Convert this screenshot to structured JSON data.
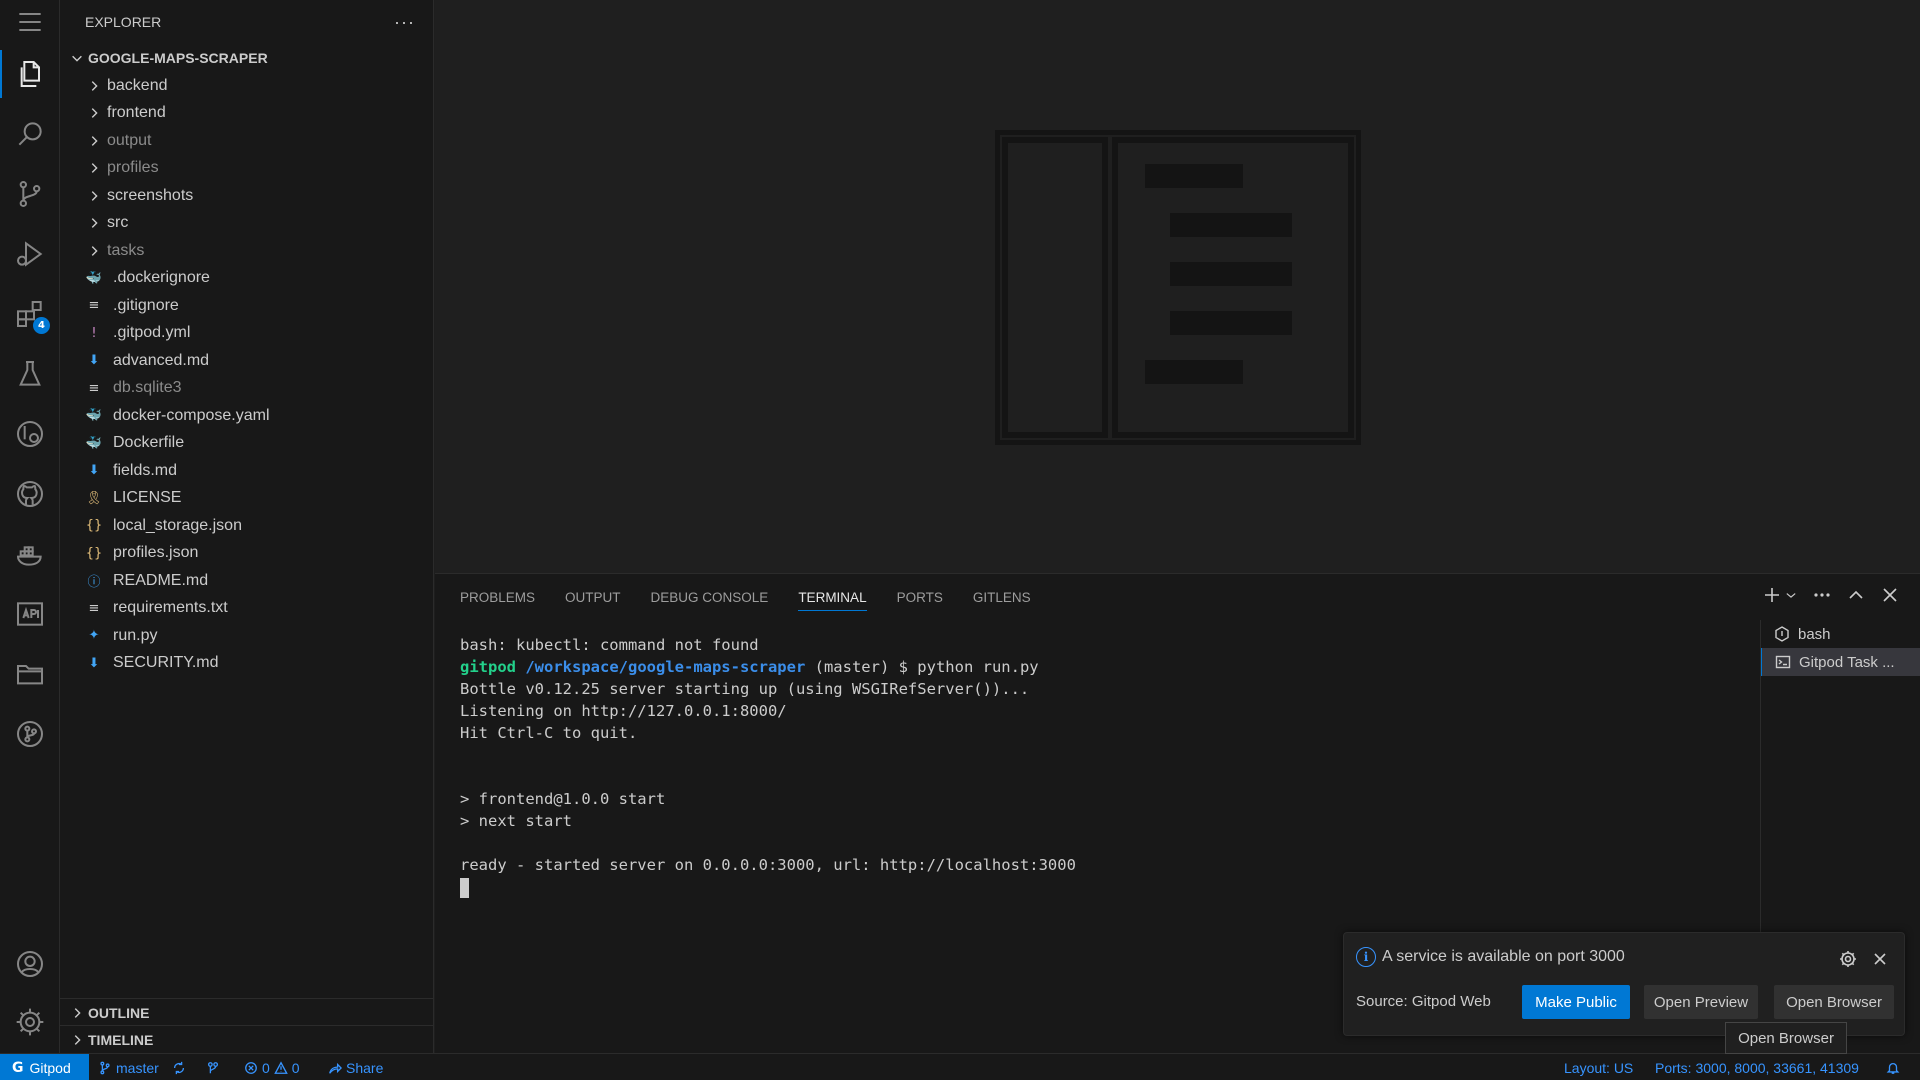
{
  "explorer": {
    "title": "EXPLORER",
    "more": "···",
    "root": "GOOGLE-MAPS-SCRAPER",
    "folders": [
      {
        "name": "backend",
        "dim": false
      },
      {
        "name": "frontend",
        "dim": false
      },
      {
        "name": "output",
        "dim": true
      },
      {
        "name": "profiles",
        "dim": true
      },
      {
        "name": "screenshots",
        "dim": false
      },
      {
        "name": "src",
        "dim": false
      },
      {
        "name": "tasks",
        "dim": true
      }
    ],
    "files": [
      {
        "name": ".dockerignore",
        "icon": "docker-icon",
        "dim": false
      },
      {
        "name": ".gitignore",
        "icon": "lines-icon",
        "dim": false
      },
      {
        "name": ".gitpod.yml",
        "icon": "exclamation-icon",
        "dim": false
      },
      {
        "name": "advanced.md",
        "icon": "markdown-arrow-icon",
        "dim": false
      },
      {
        "name": "db.sqlite3",
        "icon": "lines-icon",
        "dim": true
      },
      {
        "name": "docker-compose.yaml",
        "icon": "docker-compose-icon",
        "dim": false
      },
      {
        "name": "Dockerfile",
        "icon": "docker-icon",
        "dim": false
      },
      {
        "name": "fields.md",
        "icon": "markdown-arrow-icon",
        "dim": false
      },
      {
        "name": "LICENSE",
        "icon": "license-ribbon-icon",
        "dim": false
      },
      {
        "name": "local_storage.json",
        "icon": "json-braces-icon",
        "dim": false
      },
      {
        "name": "profiles.json",
        "icon": "json-braces-icon",
        "dim": false
      },
      {
        "name": "README.md",
        "icon": "info-icon",
        "dim": false
      },
      {
        "name": "requirements.txt",
        "icon": "lines-icon",
        "dim": false
      },
      {
        "name": "run.py",
        "icon": "python-icon",
        "dim": false
      },
      {
        "name": "SECURITY.md",
        "icon": "markdown-arrow-icon",
        "dim": false
      }
    ],
    "outline": "OUTLINE",
    "timeline": "TIMELINE"
  },
  "activity_bar": {
    "extensions_badge": "4",
    "icons": [
      "menu-icon",
      "files-icon",
      "search-icon",
      "source-control-icon",
      "run-debug-icon",
      "extensions-icon",
      "testing-icon",
      "remote-explorer-icon",
      "github-icon",
      "docker-icon",
      "api-icon",
      "folder-icon",
      "git-graph-icon",
      "account-icon",
      "settings-gear-icon"
    ]
  },
  "panel": {
    "tabs": [
      "PROBLEMS",
      "OUTPUT",
      "DEBUG CONSOLE",
      "TERMINAL",
      "PORTS",
      "GITLENS"
    ],
    "active_tab": "TERMINAL",
    "terminal": {
      "line1": "bash: kubectl: command not found",
      "prompt_user": "gitpod",
      "prompt_path": "/workspace/google-maps-scraper",
      "prompt_rest": " (master) $ python run.py",
      "line3": "Bottle v0.12.25 server starting up (using WSGIRefServer())...",
      "line4": "Listening on http://127.0.0.1:8000/",
      "line5": "Hit Ctrl-C to quit.",
      "line6": "> frontend@1.0.0 start",
      "line7": "> next start",
      "line8": "ready - started server on 0.0.0.0:3000, url: http://localhost:3000"
    },
    "terminals": [
      {
        "name": "bash",
        "active": false
      },
      {
        "name": "Gitpod Task ...",
        "active": true
      }
    ]
  },
  "notification": {
    "message": "A service is available on port 3000",
    "source": "Source: Gitpod Web",
    "primary_button": "Make Public",
    "preview_button": "Open Preview",
    "browser_button": "Open Browser",
    "tooltip": "Open Browser"
  },
  "statusbar": {
    "remote": "Gitpod",
    "branch": "master",
    "errors": "0",
    "warnings": "0",
    "share": "Share",
    "layout": "Layout: US",
    "ports": "Ports: 3000, 8000, 33661, 41309"
  },
  "colors": {
    "accent": "#0078d4",
    "link": "#3794ff",
    "terminal_green": "#23d18b",
    "terminal_blue": "#3b8eea"
  }
}
